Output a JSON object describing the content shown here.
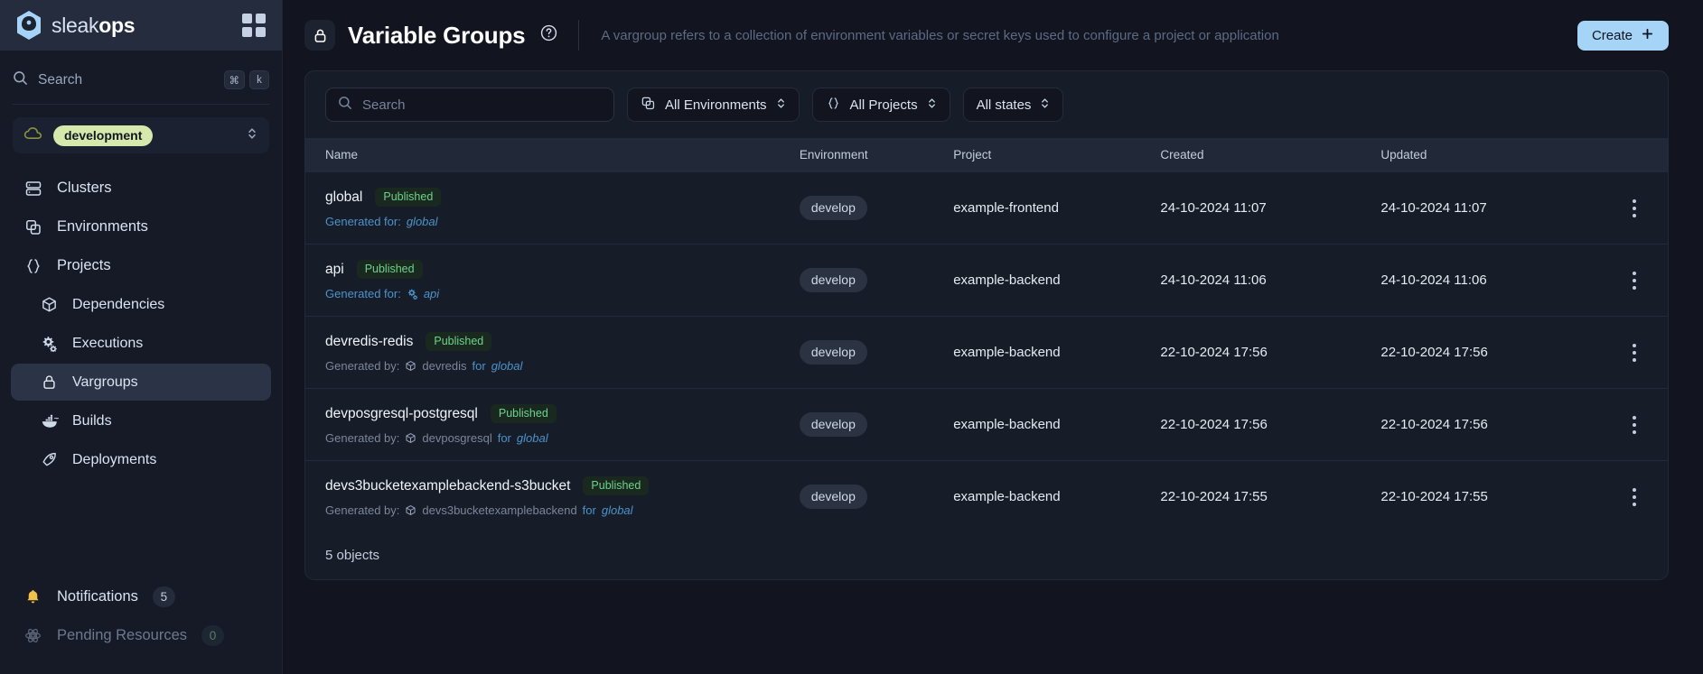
{
  "brand": {
    "name_light": "sleak",
    "name_bold": "ops",
    "grid_icon": "grid-icon"
  },
  "sidebar": {
    "search": {
      "placeholder": "Search",
      "icon": "search-icon",
      "kbd_cmd": "⌘",
      "kbd_key": "k"
    },
    "environment": {
      "label": "development",
      "icon": "cloud-icon"
    },
    "items": [
      {
        "label": "Clusters",
        "icon": "server-icon",
        "active": false,
        "sub": false
      },
      {
        "label": "Environments",
        "icon": "copy-icon",
        "active": false,
        "sub": false
      },
      {
        "label": "Projects",
        "icon": "braces-icon",
        "active": false,
        "sub": false
      },
      {
        "label": "Dependencies",
        "icon": "cube-icon",
        "active": false,
        "sub": true
      },
      {
        "label": "Executions",
        "icon": "gears-icon",
        "active": false,
        "sub": true
      },
      {
        "label": "Vargroups",
        "icon": "lock-icon",
        "active": true,
        "sub": true
      },
      {
        "label": "Builds",
        "icon": "docker-whale-icon",
        "active": false,
        "sub": true
      },
      {
        "label": "Deployments",
        "icon": "rocket-icon",
        "active": false,
        "sub": true
      }
    ],
    "bottom": [
      {
        "label": "Notifications",
        "icon": "bell-icon",
        "badge": "5",
        "dim": false
      },
      {
        "label": "Pending Resources",
        "icon": "atom-icon",
        "badge": "0",
        "dim": true
      }
    ]
  },
  "header": {
    "icon": "lock-icon",
    "title": "Variable Groups",
    "help_icon": "question-circle-icon",
    "description": "A vargroup refers to a collection of environment variables or secret keys used to configure a project or application",
    "create_label": "Create",
    "create_icon": "plus-icon"
  },
  "filters": {
    "search_placeholder": "Search",
    "search_icon": "search-icon",
    "environment_label": "All Environments",
    "environment_icon": "copy-icon",
    "projects_label": "All Projects",
    "projects_icon": "braces-icon",
    "states_label": "All states",
    "chevron_icon": "chevron-updown-icon"
  },
  "table": {
    "columns": [
      "Name",
      "Environment",
      "Project",
      "Created",
      "Updated"
    ],
    "rows": [
      {
        "name": "global",
        "status": "Published",
        "sub_prefix": "Generated for:",
        "sub_style": "blue",
        "sub_icon": "",
        "sub_target": "global",
        "sub_mid": "",
        "sub_link": "",
        "environment": "develop",
        "project": "example-frontend",
        "created": "24-10-2024 11:07",
        "updated": "24-10-2024 11:07"
      },
      {
        "name": "api",
        "status": "Published",
        "sub_prefix": "Generated for:",
        "sub_style": "blue",
        "sub_icon": "gears-icon",
        "sub_target": "api",
        "sub_mid": "",
        "sub_link": "",
        "environment": "develop",
        "project": "example-backend",
        "created": "24-10-2024 11:06",
        "updated": "24-10-2024 11:06"
      },
      {
        "name": "devredis-redis",
        "status": "Published",
        "sub_prefix": "Generated by:",
        "sub_style": "gray",
        "sub_icon": "cube-icon",
        "sub_target": "devredis",
        "sub_mid": "for",
        "sub_link": "global",
        "environment": "develop",
        "project": "example-backend",
        "created": "22-10-2024 17:56",
        "updated": "22-10-2024 17:56"
      },
      {
        "name": "devposgresql-postgresql",
        "status": "Published",
        "sub_prefix": "Generated by:",
        "sub_style": "gray",
        "sub_icon": "cube-icon",
        "sub_target": "devposgresql",
        "sub_mid": "for",
        "sub_link": "global",
        "environment": "develop",
        "project": "example-backend",
        "created": "22-10-2024 17:56",
        "updated": "22-10-2024 17:56"
      },
      {
        "name": "devs3bucketexamplebackend-s3bucket",
        "status": "Published",
        "sub_prefix": "Generated by:",
        "sub_style": "gray",
        "sub_icon": "cube-icon",
        "sub_target": "devs3bucketexamplebackend",
        "sub_mid": "for",
        "sub_link": "global",
        "environment": "develop",
        "project": "example-backend",
        "created": "22-10-2024 17:55",
        "updated": "22-10-2024 17:55"
      }
    ],
    "footer": "5 objects",
    "row_menu_icon": "kebab-menu-icon"
  },
  "colors": {
    "accent_blue": "#a5d4f7",
    "env_chip": "#d7e8ad",
    "published_green": "#6fd28b",
    "link_blue": "#4b93c9"
  }
}
